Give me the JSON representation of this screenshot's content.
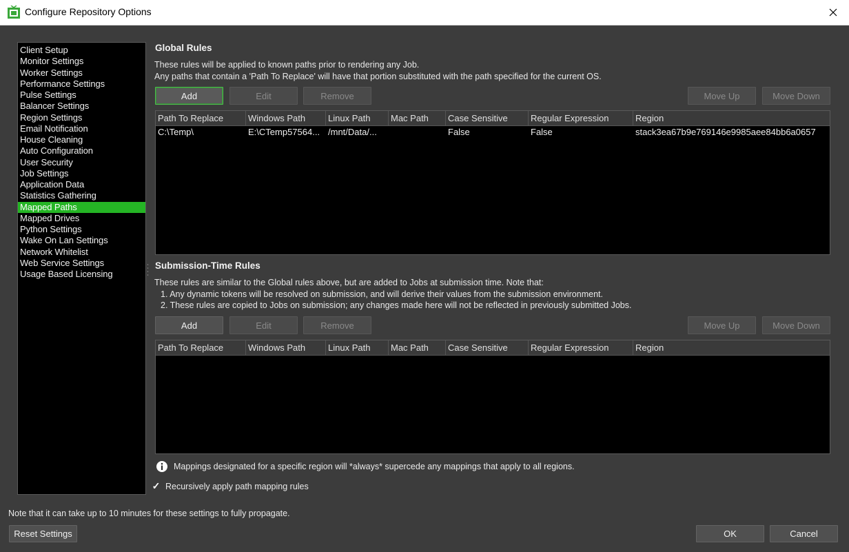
{
  "window": {
    "title": "Configure Repository Options",
    "icon": "deadline-app-icon",
    "close_glyph": "✕"
  },
  "sidebar": {
    "items": [
      {
        "label": "Client Setup",
        "selected": false
      },
      {
        "label": "Monitor Settings",
        "selected": false
      },
      {
        "label": "Worker Settings",
        "selected": false
      },
      {
        "label": "Performance Settings",
        "selected": false
      },
      {
        "label": "Pulse Settings",
        "selected": false
      },
      {
        "label": "Balancer Settings",
        "selected": false
      },
      {
        "label": "Region Settings",
        "selected": false
      },
      {
        "label": "Email Notification",
        "selected": false
      },
      {
        "label": "House Cleaning",
        "selected": false
      },
      {
        "label": "Auto Configuration",
        "selected": false
      },
      {
        "label": "User Security",
        "selected": false
      },
      {
        "label": "Job Settings",
        "selected": false
      },
      {
        "label": "Application Data",
        "selected": false
      },
      {
        "label": "Statistics Gathering",
        "selected": false
      },
      {
        "label": "Mapped Paths",
        "selected": true
      },
      {
        "label": "Mapped Drives",
        "selected": false
      },
      {
        "label": "Python Settings",
        "selected": false
      },
      {
        "label": "Wake On Lan Settings",
        "selected": false
      },
      {
        "label": "Network Whitelist",
        "selected": false
      },
      {
        "label": "Web Service Settings",
        "selected": false
      },
      {
        "label": "Usage Based Licensing",
        "selected": false
      }
    ]
  },
  "global_rules": {
    "title": "Global Rules",
    "description": [
      "These rules will be applied to known paths prior to rendering any Job.",
      "Any paths that contain a 'Path To Replace' will have that portion substituted with the path specified for the current OS."
    ],
    "buttons": {
      "add": "Add",
      "edit": "Edit",
      "remove": "Remove",
      "move_up": "Move Up",
      "move_down": "Move Down"
    },
    "columns": [
      "Path To Replace",
      "Windows Path",
      "Linux Path",
      "Mac Path",
      "Case Sensitive",
      "Regular Expression",
      "Region"
    ],
    "rows": [
      [
        "C:\\Temp\\",
        "E:\\CTemp57564...",
        "/mnt/Data/...",
        "",
        "False",
        "False",
        "stack3ea67b9e769146e9985aee84bb6a0657"
      ]
    ]
  },
  "submission_rules": {
    "title": "Submission-Time Rules",
    "description": [
      "These rules are similar to the Global rules above, but are added to Jobs at submission time. Note that:",
      "1. Any dynamic tokens will be resolved on submission, and will derive their values from the submission environment.",
      "2. These rules are copied to Jobs on submission; any changes made here will not be reflected in previously submitted Jobs."
    ],
    "buttons": {
      "add": "Add",
      "edit": "Edit",
      "remove": "Remove",
      "move_up": "Move Up",
      "move_down": "Move Down"
    },
    "columns": [
      "Path To Replace",
      "Windows Path",
      "Linux Path",
      "Mac Path",
      "Case Sensitive",
      "Regular Expression",
      "Region"
    ],
    "rows": []
  },
  "info": {
    "text": "Mappings designated for a specific region will *always* supercede any mappings that apply to all regions.",
    "icon": "info-icon"
  },
  "recursive_option": {
    "label": "Recursively apply path mapping rules",
    "checked": true,
    "check_glyph": "✓"
  },
  "footer": {
    "note": "Note that it can take up to 10 minutes for these settings to fully propagate.",
    "reset": "Reset Settings",
    "ok": "OK",
    "cancel": "Cancel"
  },
  "colors": {
    "selection": "#25b525",
    "focus_border": "#4dbb4d",
    "background": "#3c3c3c",
    "table_bg": "#000000"
  }
}
